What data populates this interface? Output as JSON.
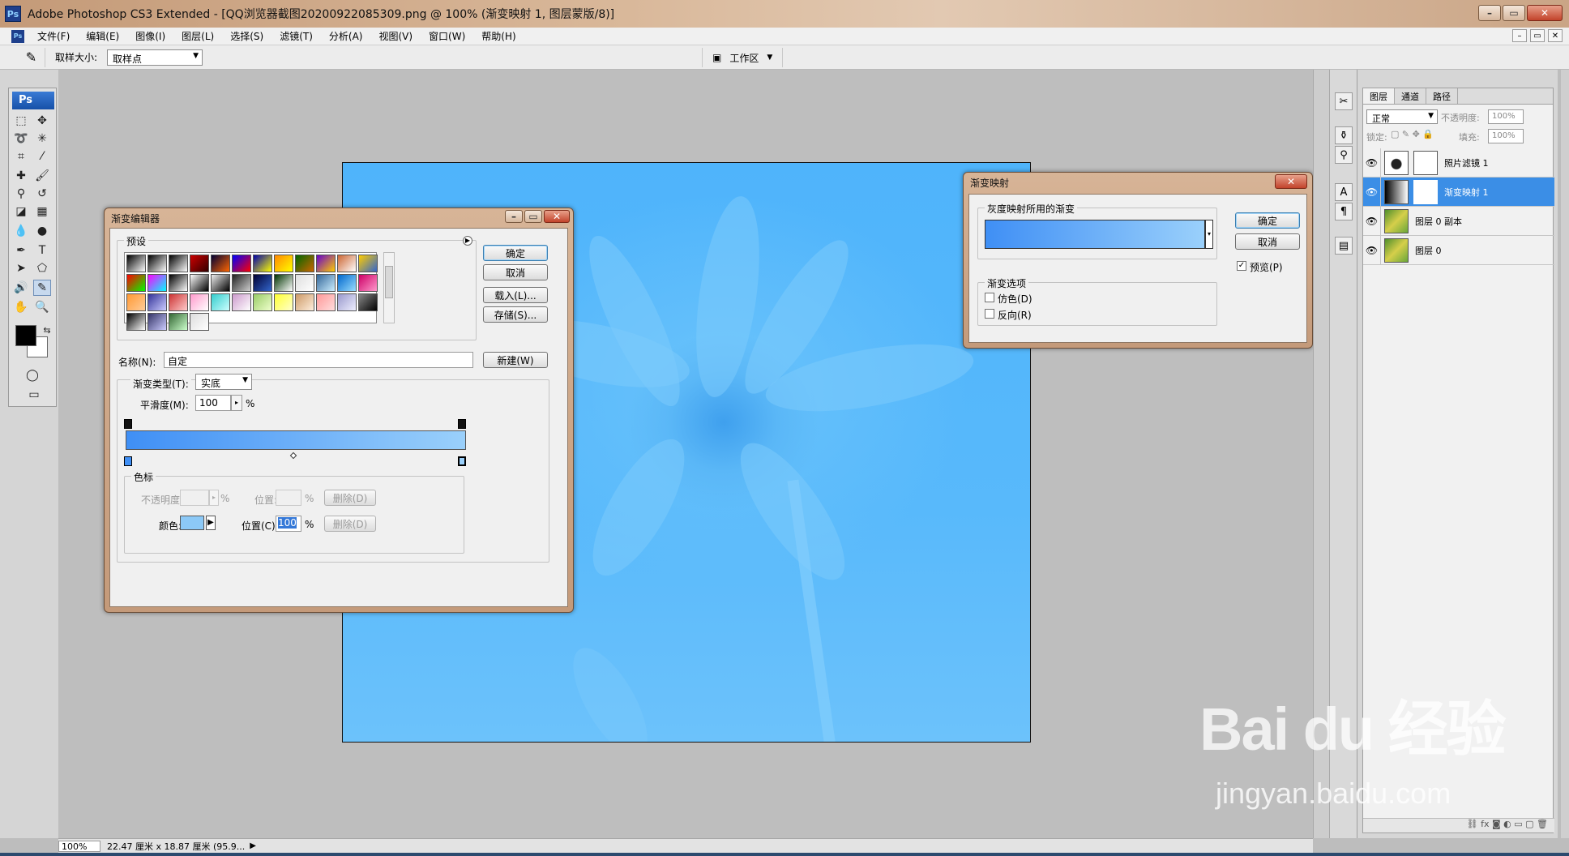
{
  "window": {
    "title": "Adobe Photoshop CS3 Extended - [QQ浏览器截图20200922085309.png @ 100% (渐变映射 1, 图层蒙版/8)]",
    "app_icon": "Ps",
    "min_icon": "minimize-icon",
    "max_icon": "maximize-icon",
    "close_icon": "close-icon"
  },
  "menu": {
    "items": [
      "文件(F)",
      "编辑(E)",
      "图像(I)",
      "图层(L)",
      "选择(S)",
      "滤镜(T)",
      "分析(A)",
      "视图(V)",
      "窗口(W)",
      "帮助(H)"
    ]
  },
  "options": {
    "sample_size_label": "取样大小:",
    "sample_size_value": "取样点",
    "workspace_label": "工作区"
  },
  "toolbox": {
    "badge": "Ps"
  },
  "gradient_editor": {
    "title": "渐变编辑器",
    "presets_label": "预设",
    "ok": "确定",
    "cancel": "取消",
    "load": "载入(L)...",
    "save": "存储(S)...",
    "name_label": "名称(N):",
    "name_value": "自定",
    "new_button": "新建(W)",
    "type_label": "渐变类型(T):",
    "type_value": "实底",
    "smoothness_label": "平滑度(M):",
    "smoothness_value": "100",
    "percent": "%",
    "stops_label": "色标",
    "opacity_label": "不透明度:",
    "location_label_1": "位置:",
    "delete_1": "删除(D)",
    "color_label": "颜色:",
    "location_label_2": "位置(C):",
    "location_value_2": "100",
    "delete_2": "删除(D)",
    "gradient_from": "#3f8ff5",
    "gradient_to": "#9ad0fb",
    "stop_color": "#8cc9f7"
  },
  "gradient_map": {
    "title": "渐变映射",
    "group_label": "灰度映射所用的渐变",
    "ok": "确定",
    "cancel": "取消",
    "preview_label": "预览(P)",
    "preview_checked": true,
    "options_label": "渐变选项",
    "dither_label": "仿色(D)",
    "reverse_label": "反向(R)"
  },
  "layers_panel": {
    "tabs": [
      "图层",
      "通道",
      "路径"
    ],
    "blend_mode": "正常",
    "opacity_label": "不透明度:",
    "opacity_value": "100%",
    "lock_label": "锁定:",
    "fill_label": "填充:",
    "fill_value": "100%",
    "layers": [
      {
        "name": "照片滤镜 1",
        "selected": false
      },
      {
        "name": "渐变映射 1",
        "selected": true
      },
      {
        "name": "图层 0 副本",
        "selected": false
      },
      {
        "name": "图层 0",
        "selected": false
      }
    ]
  },
  "status": {
    "zoom": "100%",
    "info": "22.47 厘米 x 18.87 厘米 (95.9..."
  },
  "watermark": {
    "brand": "Bai du 经验",
    "url": "jingyan.baidu.com"
  }
}
